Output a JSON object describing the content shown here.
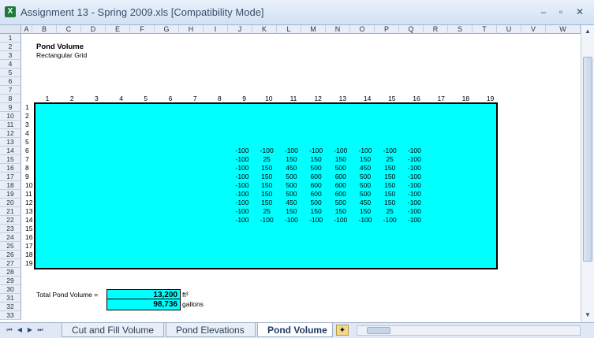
{
  "window": {
    "title": "Assignment 13 - Spring 2009.xls  [Compatibility Mode]",
    "app_icon": "X",
    "min_glyph": "–",
    "max_glyph": "▫",
    "close_glyph": "✕"
  },
  "columns": [
    "A",
    "B",
    "C",
    "D",
    "E",
    "F",
    "G",
    "H",
    "I",
    "J",
    "K",
    "L",
    "M",
    "N",
    "O",
    "P",
    "Q",
    "R",
    "S",
    "T",
    "U",
    "V",
    "W"
  ],
  "rows": [
    "1",
    "2",
    "3",
    "4",
    "5",
    "6",
    "7",
    "8",
    "9",
    "10",
    "11",
    "12",
    "13",
    "14",
    "15",
    "16",
    "17",
    "18",
    "19",
    "20",
    "21",
    "22",
    "23",
    "24",
    "25",
    "26",
    "27",
    "28",
    "29",
    "30",
    "31",
    "32",
    "33"
  ],
  "sheet": {
    "title": "Pond Volume",
    "subtitle": "Rectangular Grid",
    "grid_columns": [
      "1",
      "2",
      "3",
      "4",
      "5",
      "6",
      "7",
      "8",
      "9",
      "10",
      "11",
      "12",
      "13",
      "14",
      "15",
      "16",
      "17",
      "18",
      "19"
    ],
    "grid_rows": [
      "1",
      "2",
      "3",
      "4",
      "5",
      "6",
      "7",
      "8",
      "9",
      "10",
      "11",
      "12",
      "13",
      "14",
      "15",
      "16",
      "17",
      "18",
      "19"
    ],
    "values": [
      [
        "-100",
        "-100",
        "-100",
        "-100",
        "-100",
        "-100",
        "-100",
        "-100"
      ],
      [
        "-100",
        "25",
        "150",
        "150",
        "150",
        "150",
        "25",
        "-100"
      ],
      [
        "-100",
        "150",
        "450",
        "500",
        "500",
        "450",
        "150",
        "-100"
      ],
      [
        "-100",
        "150",
        "500",
        "600",
        "600",
        "500",
        "150",
        "-100"
      ],
      [
        "-100",
        "150",
        "500",
        "600",
        "600",
        "500",
        "150",
        "-100"
      ],
      [
        "-100",
        "150",
        "500",
        "600",
        "600",
        "500",
        "150",
        "-100"
      ],
      [
        "-100",
        "150",
        "450",
        "500",
        "500",
        "450",
        "150",
        "-100"
      ],
      [
        "-100",
        "25",
        "150",
        "150",
        "150",
        "150",
        "25",
        "-100"
      ],
      [
        "-100",
        "-100",
        "-100",
        "-100",
        "-100",
        "-100",
        "-100",
        "-100"
      ]
    ],
    "total_label": "Total Pond Volume =",
    "total_ft3": "13,200",
    "unit_ft3": "ft³",
    "total_gallons": "98,736",
    "unit_gallons": "gallons"
  },
  "tabs": {
    "nav": [
      "⏮",
      "◀",
      "▶",
      "⏭"
    ],
    "items": [
      "Cut and Fill Volume",
      "Pond Elevations",
      "Pond Volume"
    ],
    "active": "Pond Volume",
    "new_sheet_icon": "✦"
  },
  "scroll": {
    "up": "▲",
    "down": "▼",
    "left": "◀",
    "right": "▶"
  }
}
